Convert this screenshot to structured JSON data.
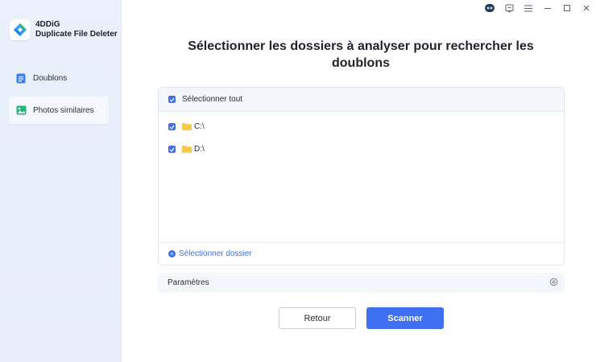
{
  "app": {
    "name_line1": "4DDiG",
    "name_line2": "Duplicate File Deleter"
  },
  "sidebar": {
    "items": [
      {
        "label": "Doublons",
        "icon": "document-icon"
      },
      {
        "label": "Photos similaires",
        "icon": "image-icon"
      }
    ]
  },
  "window_controls": [
    "assistant-icon",
    "feedback-icon",
    "menu-icon",
    "minimize-icon",
    "maximize-icon",
    "close-icon"
  ],
  "main": {
    "title": "Sélectionner les dossiers à analyser pour rechercher les doublons",
    "select_all_label": "Sélectionner tout",
    "folders": [
      {
        "label": "C:\\",
        "checked": true
      },
      {
        "label": "D:\\",
        "checked": true
      }
    ],
    "add_folder_label": "Sélectionner dossier",
    "params_label": "Paramètres",
    "back_label": "Retour",
    "scan_label": "Scanner"
  },
  "colors": {
    "accent": "#3d6ff0",
    "folder": "#f8c94a",
    "sidebar_bg": "#e8effa"
  }
}
